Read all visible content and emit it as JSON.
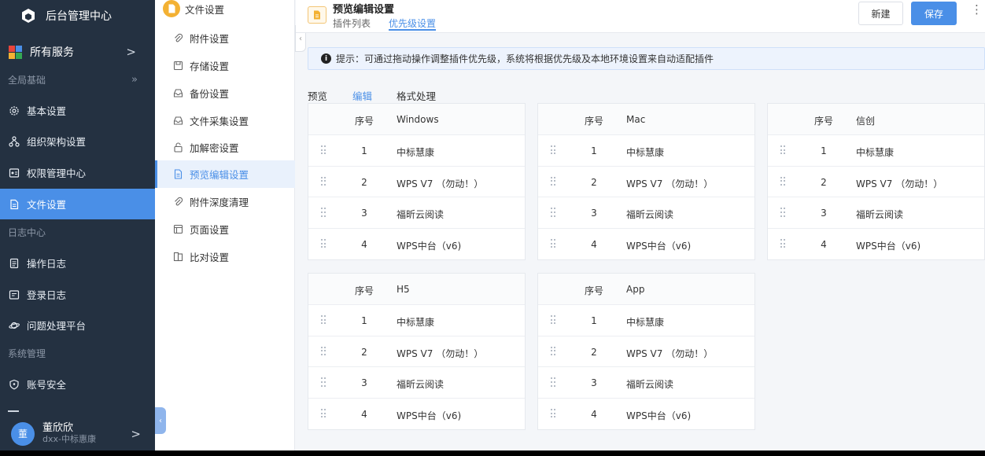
{
  "app": {
    "title": "后台管理中心"
  },
  "nav": {
    "all_services": "所有服务",
    "group_global": "全局基础",
    "items_global": [
      {
        "label": "基本设置",
        "icon": "gear-icon"
      },
      {
        "label": "组织架构设置",
        "icon": "org-icon"
      },
      {
        "label": "权限管理中心",
        "icon": "permission-icon"
      },
      {
        "label": "文件设置",
        "icon": "file-icon",
        "active": true
      }
    ],
    "group_log": "日志中心",
    "items_log": [
      {
        "label": "操作日志",
        "icon": "log-icon"
      },
      {
        "label": "登录日志",
        "icon": "login-log-icon"
      },
      {
        "label": "问题处理平台",
        "icon": "planet-icon"
      }
    ],
    "group_system": "系统管理",
    "items_system": [
      {
        "label": "账号安全",
        "icon": "shield-icon"
      }
    ]
  },
  "user": {
    "avatar_text": "董",
    "name": "董欣欣",
    "org": "dxx-中标惠康"
  },
  "subnav": {
    "header": "文件设置",
    "items": [
      {
        "label": "附件设置"
      },
      {
        "label": "存储设置"
      },
      {
        "label": "备份设置"
      },
      {
        "label": "文件采集设置"
      },
      {
        "label": "加解密设置"
      },
      {
        "label": "预览编辑设置",
        "active": true
      },
      {
        "label": "附件深度清理"
      },
      {
        "label": "页面设置"
      },
      {
        "label": "比对设置"
      }
    ]
  },
  "page": {
    "title": "预览编辑设置",
    "tabs": [
      "插件列表",
      "优先级设置"
    ],
    "active_tab": 1,
    "new_button": "新建",
    "save_button": "保存",
    "more_icon": "⋮",
    "notice": "提示：可通过拖动操作调整插件优先级，系统将根据优先级及本地环境设置来自动适配插件",
    "modes": [
      "预览",
      "编辑",
      "格式处理"
    ],
    "active_mode": 1
  },
  "cards": [
    {
      "platform": "Windows",
      "no_header": "序号",
      "rows": [
        {
          "no": "1",
          "name": "中标慧康"
        },
        {
          "no": "2",
          "name": "WPS V7 （勿动！）"
        },
        {
          "no": "3",
          "name": "福昕云阅读"
        },
        {
          "no": "4",
          "name": "WPS中台（v6)"
        }
      ]
    },
    {
      "platform": "Mac",
      "no_header": "序号",
      "rows": [
        {
          "no": "1",
          "name": "中标慧康"
        },
        {
          "no": "2",
          "name": "WPS V7 （勿动！）"
        },
        {
          "no": "3",
          "name": "福昕云阅读"
        },
        {
          "no": "4",
          "name": "WPS中台（v6)"
        }
      ]
    },
    {
      "platform": "信创",
      "no_header": "序号",
      "rows": [
        {
          "no": "1",
          "name": "中标慧康"
        },
        {
          "no": "2",
          "name": "WPS V7 （勿动！）"
        },
        {
          "no": "3",
          "name": "福昕云阅读"
        },
        {
          "no": "4",
          "name": "WPS中台（v6)"
        }
      ]
    },
    {
      "platform": "H5",
      "no_header": "序号",
      "rows": [
        {
          "no": "1",
          "name": "中标慧康"
        },
        {
          "no": "2",
          "name": "WPS V7 （勿动！）"
        },
        {
          "no": "3",
          "name": "福昕云阅读"
        },
        {
          "no": "4",
          "name": "WPS中台（v6)"
        }
      ]
    },
    {
      "platform": "App",
      "no_header": "序号",
      "rows": [
        {
          "no": "1",
          "name": "中标慧康"
        },
        {
          "no": "2",
          "name": "WPS V7 （勿动！）"
        },
        {
          "no": "3",
          "name": "福昕云阅读"
        },
        {
          "no": "4",
          "name": "WPS中台（v6)"
        }
      ]
    }
  ],
  "colors": {
    "accent": "#4a8fe7",
    "nav_bg": "#243141"
  }
}
